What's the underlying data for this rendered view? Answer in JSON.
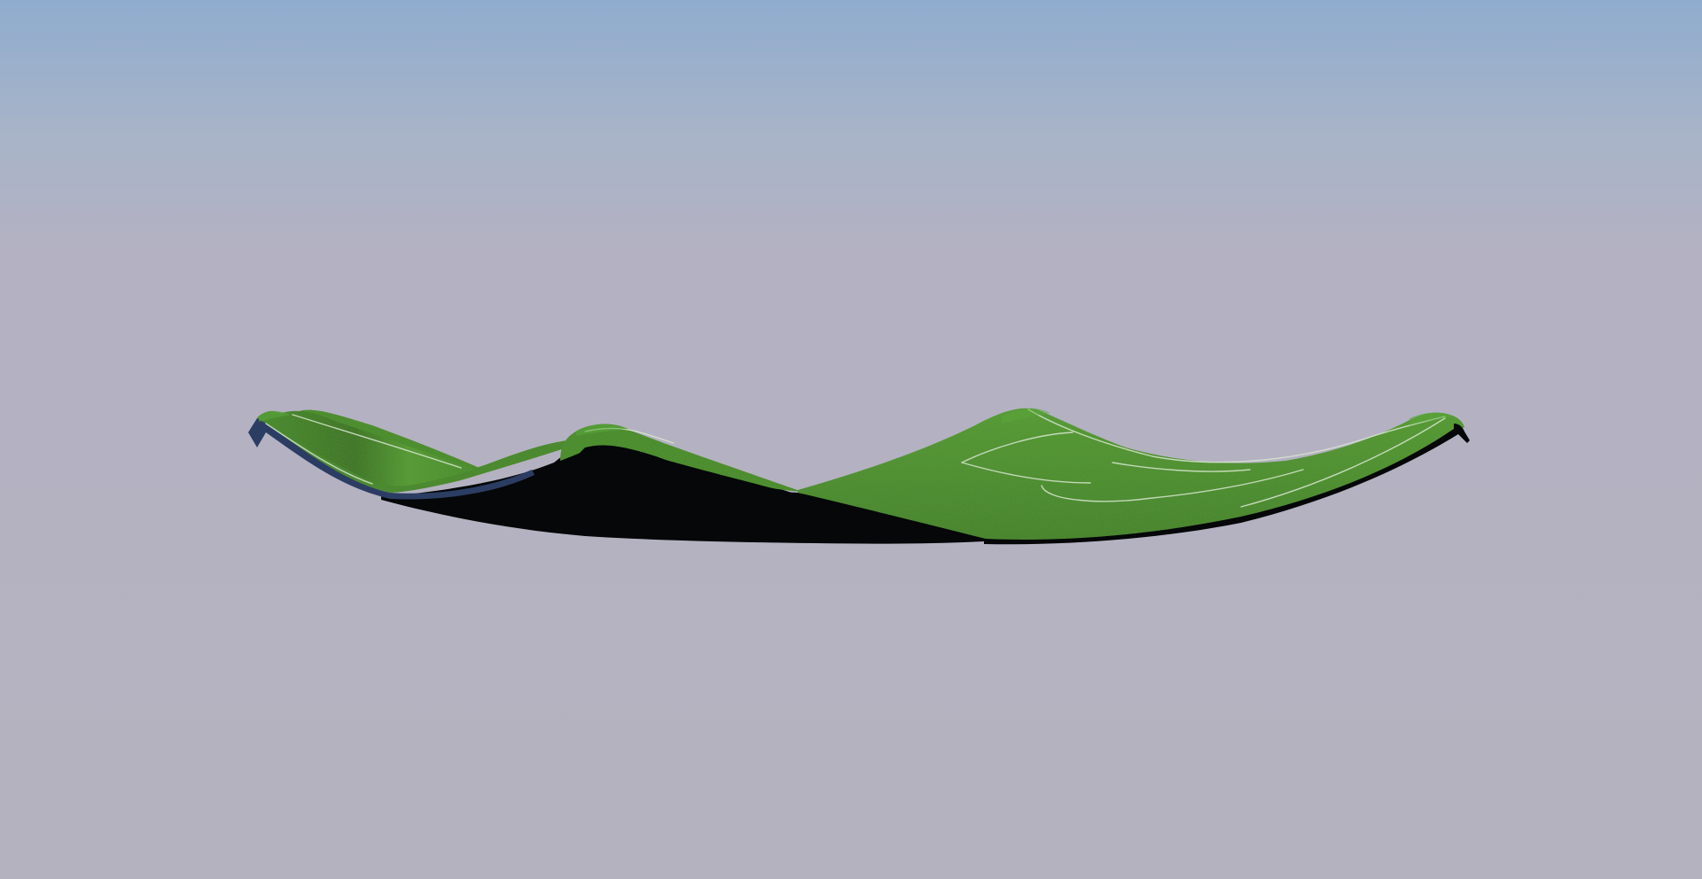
{
  "scene": {
    "subject": "curved-green-pitch-surface",
    "colors": {
      "sky_top": "#8facce",
      "sky_mid": "#a9b4c8",
      "horizon": "#b4b1c2",
      "ground": "#b5b2c0",
      "grass_light": "#4f9a2e",
      "grass_mid": "#3f8a24",
      "grass_dark": "#2f6e1a",
      "underside": "#050708",
      "edge_blue": "#2c3d63",
      "pitch_line": "#d8e6d0"
    }
  }
}
